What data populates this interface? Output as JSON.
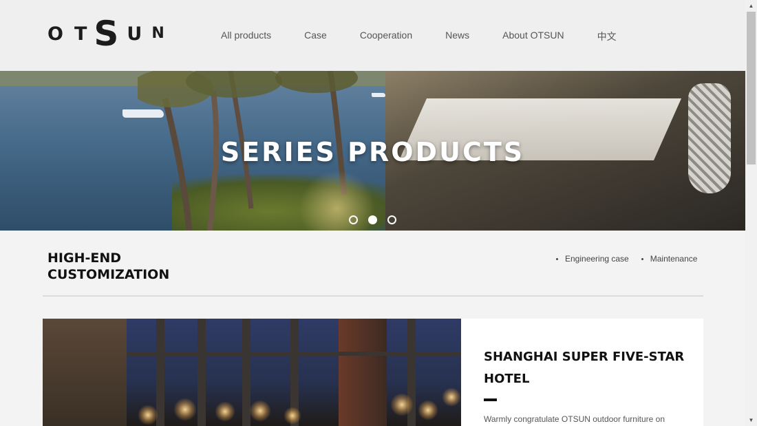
{
  "header": {
    "logo": {
      "letters": [
        "O",
        "T",
        "S",
        "U",
        "N"
      ]
    },
    "nav": [
      "All products",
      "Case",
      "Cooperation",
      "News",
      "About OTSUN",
      "中文"
    ]
  },
  "hero": {
    "title": "SERIES PRODUCTS",
    "slides": 3,
    "active_slide": 2
  },
  "section": {
    "title_line1": "HIGH-END",
    "title_line2": "CUSTOMIZATION",
    "links": [
      "Engineering case",
      "Maintenance"
    ]
  },
  "case": {
    "title": "SHANGHAI SUPER FIVE-STAR HOTEL",
    "text": "Warmly congratulate OTSUN outdoor furniture on"
  },
  "icons": {
    "scroll_up": "triangle-up-icon",
    "scroll_down": "triangle-down-icon"
  }
}
